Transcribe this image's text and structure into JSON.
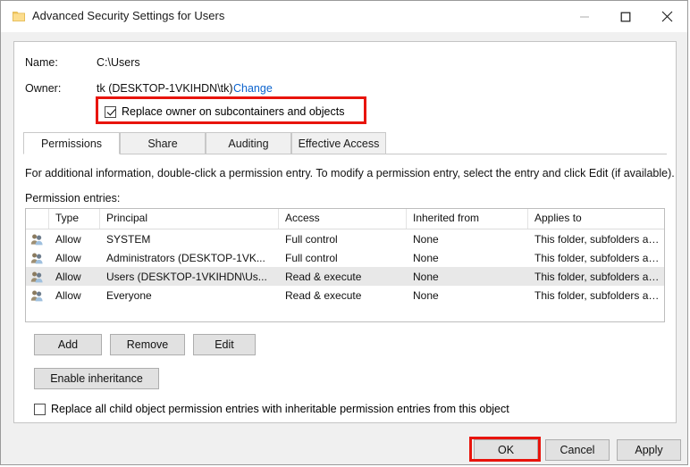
{
  "window": {
    "title": "Advanced Security Settings for Users",
    "icon": "folder-icon",
    "controls": {
      "minimize": "minimize-icon",
      "maximize": "maximize-icon",
      "close": "close-icon"
    }
  },
  "fields": {
    "name_label": "Name:",
    "name_value": "C:\\Users",
    "owner_label": "Owner:",
    "owner_value": "tk (DESKTOP-1VKIHDN\\tk)",
    "change_link": "Change"
  },
  "replace_owner_checkbox": {
    "label": "Replace owner on subcontainers and objects",
    "checked": true
  },
  "tabs": [
    {
      "label": "Permissions",
      "active": true
    },
    {
      "label": "Share",
      "active": false
    },
    {
      "label": "Auditing",
      "active": false
    },
    {
      "label": "Effective Access",
      "active": false
    }
  ],
  "info_text": "For additional information, double-click a permission entry. To modify a permission entry, select the entry and click Edit (if available).",
  "entries_label": "Permission entries:",
  "table": {
    "columns": [
      "",
      "Type",
      "Principal",
      "Access",
      "Inherited from",
      "Applies to"
    ],
    "rows": [
      {
        "icon": "users-group-icon",
        "type": "Allow",
        "principal": "SYSTEM",
        "access": "Full control",
        "inherited_from": "None",
        "applies_to": "This folder, subfolders and files",
        "selected": false
      },
      {
        "icon": "users-group-icon",
        "type": "Allow",
        "principal": "Administrators (DESKTOP-1VK...",
        "access": "Full control",
        "inherited_from": "None",
        "applies_to": "This folder, subfolders and files",
        "selected": false
      },
      {
        "icon": "users-group-icon",
        "type": "Allow",
        "principal": "Users (DESKTOP-1VKIHDN\\Us...",
        "access": "Read & execute",
        "inherited_from": "None",
        "applies_to": "This folder, subfolders and files",
        "selected": true
      },
      {
        "icon": "users-group-icon",
        "type": "Allow",
        "principal": "Everyone",
        "access": "Read & execute",
        "inherited_from": "None",
        "applies_to": "This folder, subfolders and files",
        "selected": false
      }
    ]
  },
  "actions": {
    "add": "Add",
    "remove": "Remove",
    "edit": "Edit",
    "enable_inheritance": "Enable inheritance"
  },
  "replace_child_checkbox": {
    "label": "Replace all child object permission entries with inheritable permission entries from this object",
    "checked": false
  },
  "footer": {
    "ok": "OK",
    "cancel": "Cancel",
    "apply": "Apply"
  },
  "annotations": {
    "color": "#e8140c",
    "targets": [
      "replace-owner-checkbox",
      "ok-button"
    ]
  }
}
